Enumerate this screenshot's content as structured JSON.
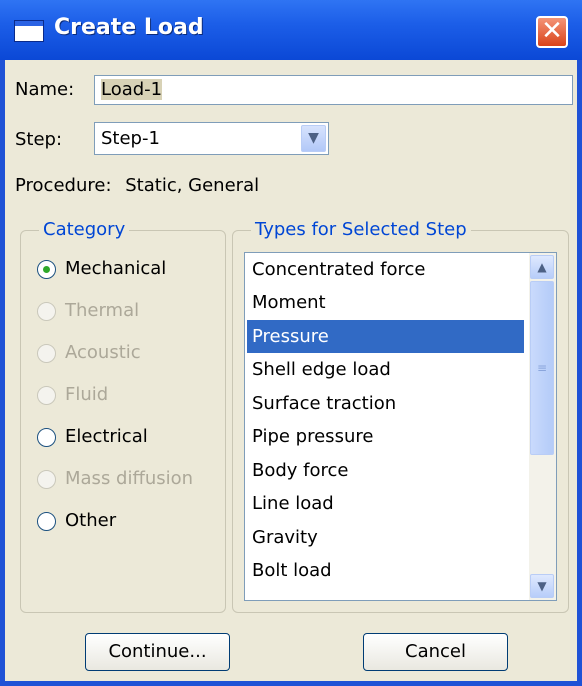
{
  "window": {
    "title": "Create Load"
  },
  "form": {
    "name_label": "Name:",
    "name_value": "Load-1",
    "step_label": "Step:",
    "step_value": "Step-1",
    "procedure_label": "Procedure:",
    "procedure_value": "Static, General"
  },
  "category": {
    "legend": "Category",
    "options": [
      {
        "label": "Mechanical",
        "selected": true,
        "enabled": true
      },
      {
        "label": "Thermal",
        "selected": false,
        "enabled": false
      },
      {
        "label": "Acoustic",
        "selected": false,
        "enabled": false
      },
      {
        "label": "Fluid",
        "selected": false,
        "enabled": false
      },
      {
        "label": "Electrical",
        "selected": false,
        "enabled": true
      },
      {
        "label": "Mass diffusion",
        "selected": false,
        "enabled": false
      },
      {
        "label": "Other",
        "selected": false,
        "enabled": true
      }
    ]
  },
  "types": {
    "legend": "Types for Selected Step",
    "items": [
      "Concentrated force",
      "Moment",
      "Pressure",
      "Shell edge load",
      "Surface traction",
      "Pipe pressure",
      "Body force",
      "Line load",
      "Gravity",
      "Bolt load"
    ],
    "selected": "Pressure"
  },
  "buttons": {
    "continue": "Continue...",
    "cancel": "Cancel"
  },
  "icons": {
    "app": "window-icon",
    "close": "close-icon",
    "combo": "chevron-down-icon",
    "scroll_up": "arrow-up-icon",
    "scroll_down": "arrow-down-icon"
  },
  "colors": {
    "title_bar": "#0b48d6",
    "selection": "#316ac5",
    "legend_text": "#0046d5",
    "radio_dot": "#2fa82a"
  }
}
